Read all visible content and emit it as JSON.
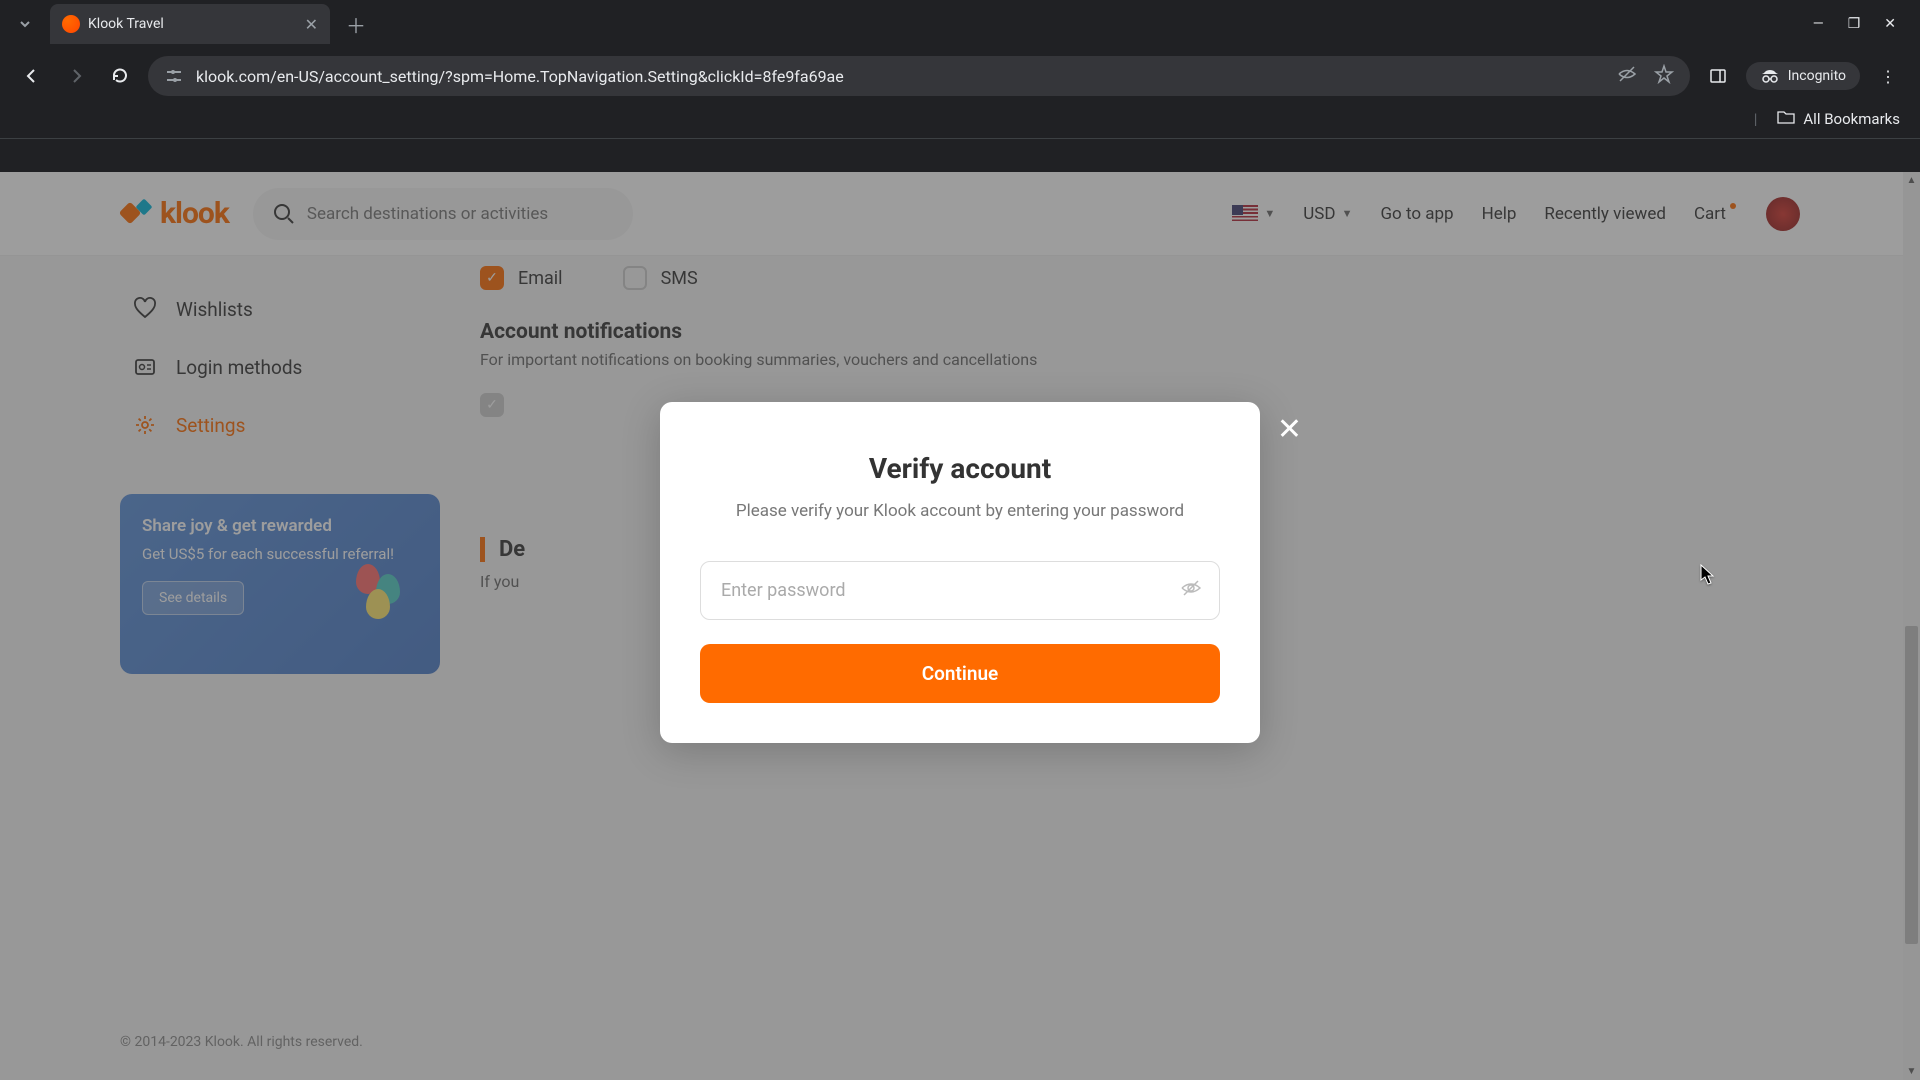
{
  "browser": {
    "tab_title": "Klook Travel",
    "url": "klook.com/en-US/account_setting/?spm=Home.TopNavigation.Setting&clickId=8fe9fa69ae",
    "incognito_label": "Incognito",
    "all_bookmarks": "All Bookmarks"
  },
  "header": {
    "logo_text": "klook",
    "search_placeholder": "Search destinations or activities",
    "currency": "USD",
    "go_to_app": "Go to app",
    "help": "Help",
    "recently_viewed": "Recently viewed",
    "cart": "Cart"
  },
  "sidebar": {
    "wishlists": "Wishlists",
    "login_methods": "Login methods",
    "settings": "Settings"
  },
  "promo": {
    "title": "Share joy & get rewarded",
    "subtitle": "Get US$5 for each successful referral!",
    "cta": "See details"
  },
  "content": {
    "email": "Email",
    "sms": "SMS",
    "notif_heading": "Account notifications",
    "notif_desc": "For important notifications on booking summaries, vouchers and cancellations",
    "delete_heading": "De",
    "delete_desc": "If you"
  },
  "modal": {
    "title": "Verify account",
    "desc": "Please verify your Klook account by entering your password",
    "placeholder": "Enter password",
    "button": "Continue"
  },
  "footer": {
    "copyright": "© 2014-2023 Klook. All rights reserved."
  }
}
